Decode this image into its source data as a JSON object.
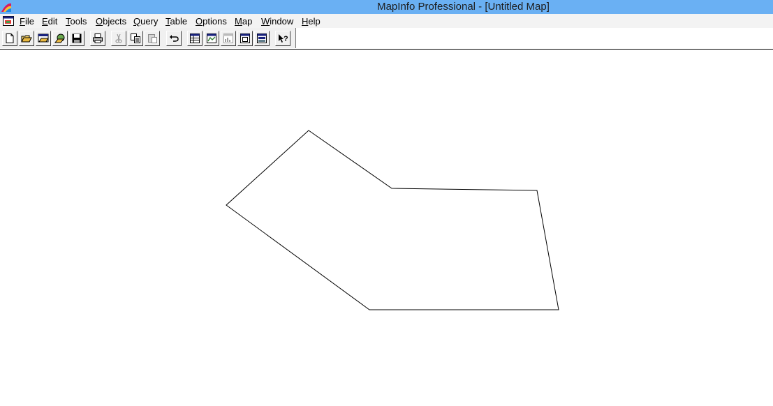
{
  "window": {
    "title": "MapInfo Professional - [Untitled Map]"
  },
  "menu": {
    "items": [
      {
        "id": "file",
        "label": "File"
      },
      {
        "id": "edit",
        "label": "Edit"
      },
      {
        "id": "tools",
        "label": "Tools"
      },
      {
        "id": "objects",
        "label": "Objects"
      },
      {
        "id": "query",
        "label": "Query"
      },
      {
        "id": "table",
        "label": "Table"
      },
      {
        "id": "options",
        "label": "Options"
      },
      {
        "id": "map",
        "label": "Map"
      },
      {
        "id": "window",
        "label": "Window"
      },
      {
        "id": "help",
        "label": "Help"
      }
    ]
  },
  "toolbar": {
    "buttons": [
      {
        "icon": "new-document-icon"
      },
      {
        "icon": "open-folder-icon"
      },
      {
        "icon": "open-workspace-icon"
      },
      {
        "icon": "open-dbms-icon"
      },
      {
        "icon": "save-icon"
      },
      {
        "icon": "print-icon"
      },
      {
        "icon": "cut-icon",
        "enabled": false
      },
      {
        "icon": "copy-icon"
      },
      {
        "icon": "paste-icon",
        "enabled": false
      },
      {
        "icon": "undo-icon"
      },
      {
        "icon": "new-browser-icon"
      },
      {
        "icon": "new-mapper-icon"
      },
      {
        "icon": "new-graph-icon",
        "enabled": false
      },
      {
        "icon": "new-layout-icon"
      },
      {
        "icon": "new-redistrict-icon"
      },
      {
        "icon": "help-pointer-icon"
      }
    ]
  },
  "colors": {
    "titlebar": "#6ab0f3",
    "menubar": "#f3f3f3",
    "polygon_stroke": "#000000"
  }
}
